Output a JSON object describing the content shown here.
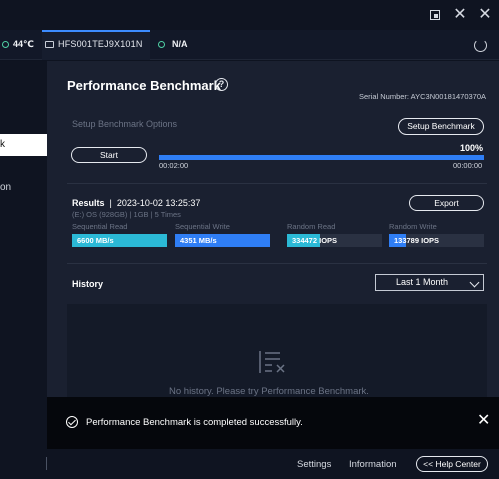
{
  "window": {
    "restore_icon": "restore-icon",
    "close_icon": "close-icon"
  },
  "drivebar": {
    "temperature": "44℃",
    "drive_name": "HFS001TEJ9X101N",
    "status": "N/A"
  },
  "sidebar": {
    "active_item_label": "k",
    "item2_label": "on"
  },
  "page": {
    "title": "Performance Benchmark",
    "serial_number": "Serial Number: AYC3N00181470370A"
  },
  "setup": {
    "label": "Setup Benchmark Options",
    "button": "Setup Benchmark",
    "start_button": "Start",
    "progress_percent": "100%",
    "progress_value": 1.0,
    "time_elapsed": "00:02:00",
    "time_remaining": "00:00:00"
  },
  "results": {
    "title": "Results",
    "datetime": "2023-10-02 13:25:37",
    "meta": "(E:) OS (928GB)  |  1GB  |  5 Times",
    "export_button": "Export",
    "metrics": [
      {
        "label": "Sequential Read",
        "value": "6600 MB/s",
        "fill": 1.0,
        "color": "#2bb9d6"
      },
      {
        "label": "Sequential Write",
        "value": "4351 MB/s",
        "fill": 1.0,
        "color": "#2f7ef5"
      },
      {
        "label": "Random Read",
        "value": "334472 IOPS",
        "fill": 0.35,
        "color": "#2bb9d6"
      },
      {
        "label": "Random Write",
        "value": "133789 IOPS",
        "fill": 0.18,
        "color": "#2f7ef5"
      }
    ]
  },
  "history": {
    "title": "History",
    "range_selected": "Last 1 Month",
    "empty_text": "No history. Please try Performance Benchmark."
  },
  "toast": {
    "message": "Performance Benchmark is completed successfully."
  },
  "footer": {
    "settings": "Settings",
    "information": "Information",
    "help_center": "<< Help Center"
  }
}
